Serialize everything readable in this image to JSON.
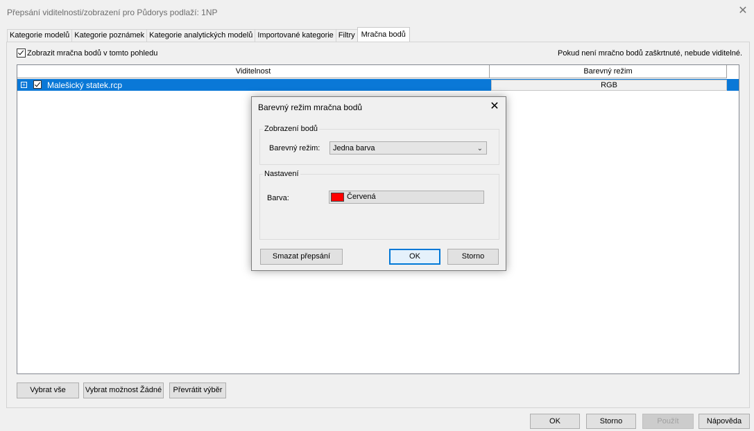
{
  "window": {
    "title": "Přepsání viditelnosti/zobrazení pro Půdorys podlaží: 1NP",
    "close_icon": "close-icon"
  },
  "tabs": [
    {
      "label": "Kategorie modelů",
      "active": false
    },
    {
      "label": "Kategorie poznámek",
      "active": false
    },
    {
      "label": "Kategorie analytických modelů",
      "active": false
    },
    {
      "label": "Importované kategorie",
      "active": false
    },
    {
      "label": "Filtry",
      "active": false
    },
    {
      "label": "Mračna bodů",
      "active": true
    }
  ],
  "show_clouds": {
    "label": "Zobrazit mračna bodů v tomto pohledu",
    "checked": true
  },
  "hint": "Pokud není mračno bodů zaškrtnuté, nebude viditelné.",
  "grid": {
    "columns": [
      "Viditelnost",
      "Barevný režim"
    ],
    "rows": [
      {
        "name": "Malešický statek.rcp",
        "visible": true,
        "color_mode": "RGB",
        "selected": true
      }
    ]
  },
  "bottom_left_buttons": {
    "select_all": "Vybrat vše",
    "select_none": "Vybrat možnost Žádné",
    "invert": "Převrátit výběr"
  },
  "footer_buttons": {
    "ok": "OK",
    "cancel": "Storno",
    "apply": "Použít",
    "help": "Nápověda"
  },
  "dialog": {
    "title": "Barevný režim mračna bodů",
    "group_points": "Zobrazení bodů",
    "color_mode_label": "Barevný režim:",
    "color_mode_value": "Jedna barva",
    "group_settings": "Nastavení",
    "color_label": "Barva:",
    "color_value": "Červená",
    "color_hex": "#ff0000",
    "clear_override": "Smazat přepsání",
    "ok": "OK",
    "cancel": "Storno"
  }
}
